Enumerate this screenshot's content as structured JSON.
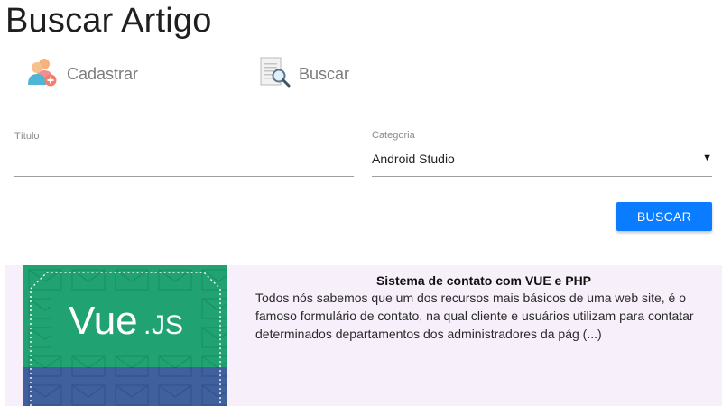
{
  "page": {
    "title": "Buscar Artigo"
  },
  "nav": {
    "cadastrar": {
      "label": "Cadastrar",
      "icon": "add-users-icon"
    },
    "buscar": {
      "label": "Buscar",
      "icon": "search-document-icon"
    }
  },
  "form": {
    "titulo": {
      "label": "Título",
      "value": "",
      "placeholder": ""
    },
    "categoria": {
      "label": "Categoria",
      "value": "Android Studio"
    },
    "submit_label": "BUSCAR"
  },
  "results": [
    {
      "title": "Sistema de contato com VUE e PHP",
      "excerpt": "Todos nós sabemos que um dos recursos mais básicos de uma web site, é o famoso formulário de contato, na qual cliente e usuários utilizam para contatar determinados departamentos dos administradores da pág (...)",
      "thumbnail": {
        "logo_main": "Vue",
        "logo_dot": ".",
        "logo_suffix": "JS",
        "icon": "vuejs-envelopes-thumbnail"
      }
    }
  ],
  "colors": {
    "accent": "#0a7cff",
    "card_bg": "#f7f0fb",
    "thumb_green": "#21a272",
    "thumb_blue": "#3f5f9d"
  }
}
